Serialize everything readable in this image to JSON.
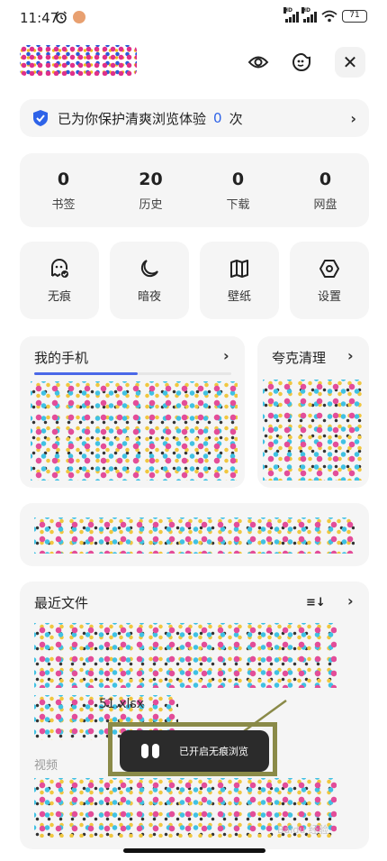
{
  "status_bar": {
    "time": "11:47",
    "signal_label": "HD",
    "battery": "71"
  },
  "shield_banner": {
    "text": "已为你保护清爽浏览体验",
    "count": "0",
    "suffix": "次"
  },
  "stats": [
    {
      "value": "0",
      "label": "书签"
    },
    {
      "value": "20",
      "label": "历史"
    },
    {
      "value": "0",
      "label": "下载"
    },
    {
      "value": "0",
      "label": "网盘"
    }
  ],
  "tools": [
    {
      "label": "无痕",
      "icon": "incognito-ghost-icon"
    },
    {
      "label": "暗夜",
      "icon": "moon-icon"
    },
    {
      "label": "壁纸",
      "icon": "wallpaper-book-icon"
    },
    {
      "label": "设置",
      "icon": "settings-hexagon-icon"
    }
  ],
  "phone_section": {
    "title": "我的手机"
  },
  "clean_section": {
    "title": "夸克清理"
  },
  "recent_files": {
    "title": "最近文件",
    "partial_file_name": "51.xlsx",
    "video_label": "视频"
  },
  "toast": {
    "text": "已开启无痕浏览"
  },
  "watermark": "Baidu 经验",
  "colors": {
    "accent_blue": "#2e63e8",
    "card_bg": "#f5f5f5",
    "toast_bg": "#2b2b2b",
    "highlight_frame": "#8a8a48"
  }
}
